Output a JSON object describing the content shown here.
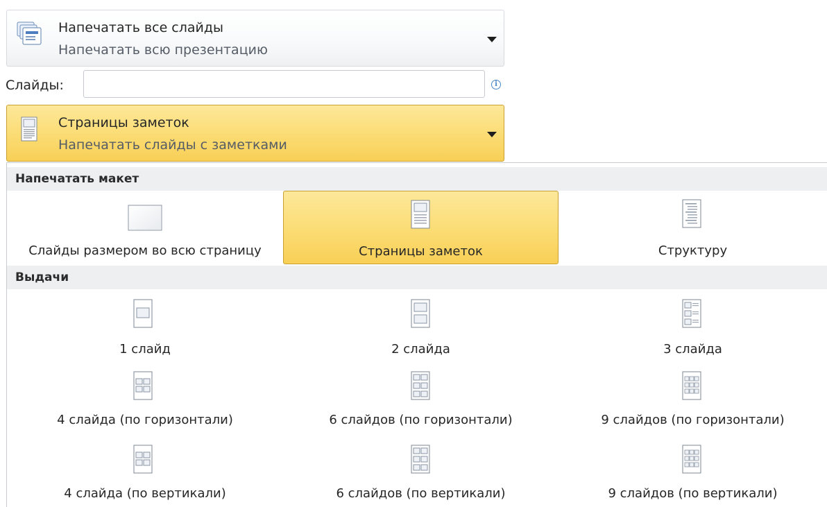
{
  "slides_dropdown": {
    "title": "Напечатать все слайды",
    "subtitle": "Напечатать всю презентацию",
    "icon": "slides-stack-icon"
  },
  "slides_field": {
    "label": "Слайды:",
    "value": "",
    "placeholder": "",
    "info_glyph": "i"
  },
  "layout_dropdown": {
    "title": "Страницы заметок",
    "subtitle": "Напечатать слайды с заметками",
    "icon": "notes-page-icon"
  },
  "gallery": {
    "layout_section": {
      "title": "Напечатать макет",
      "items": [
        {
          "label": "Слайды размером во всю страницу",
          "icon": "full-page-slide-icon",
          "selected": false
        },
        {
          "label": "Страницы заметок",
          "icon": "notes-page-icon",
          "selected": true
        },
        {
          "label": "Структуру",
          "icon": "outline-icon",
          "selected": false
        }
      ]
    },
    "handouts_section": {
      "title": "Выдачи",
      "items": [
        {
          "label": "1 слайд",
          "icon": "handout-1-icon"
        },
        {
          "label": "2 слайда",
          "icon": "handout-2-icon"
        },
        {
          "label": "3 слайда",
          "icon": "handout-3-icon"
        },
        {
          "label": "4 слайда (по горизонтали)",
          "icon": "handout-4-horizontal-icon"
        },
        {
          "label": "6 слайдов (по горизонтали)",
          "icon": "handout-6-horizontal-icon"
        },
        {
          "label": "9 слайдов (по горизонтали)",
          "icon": "handout-9-horizontal-icon"
        },
        {
          "label": "4 слайда (по вертикали)",
          "icon": "handout-4-vertical-icon"
        },
        {
          "label": "6 слайдов (по вертикали)",
          "icon": "handout-6-vertical-icon"
        },
        {
          "label": "9 слайдов (по вертикали)",
          "icon": "handout-9-vertical-icon"
        }
      ]
    }
  },
  "colors": {
    "selected_fill": "#fbdc73",
    "selected_border": "#c9a030",
    "section_header_bg": "#eeeff1",
    "info_accent": "#4a86c8"
  }
}
